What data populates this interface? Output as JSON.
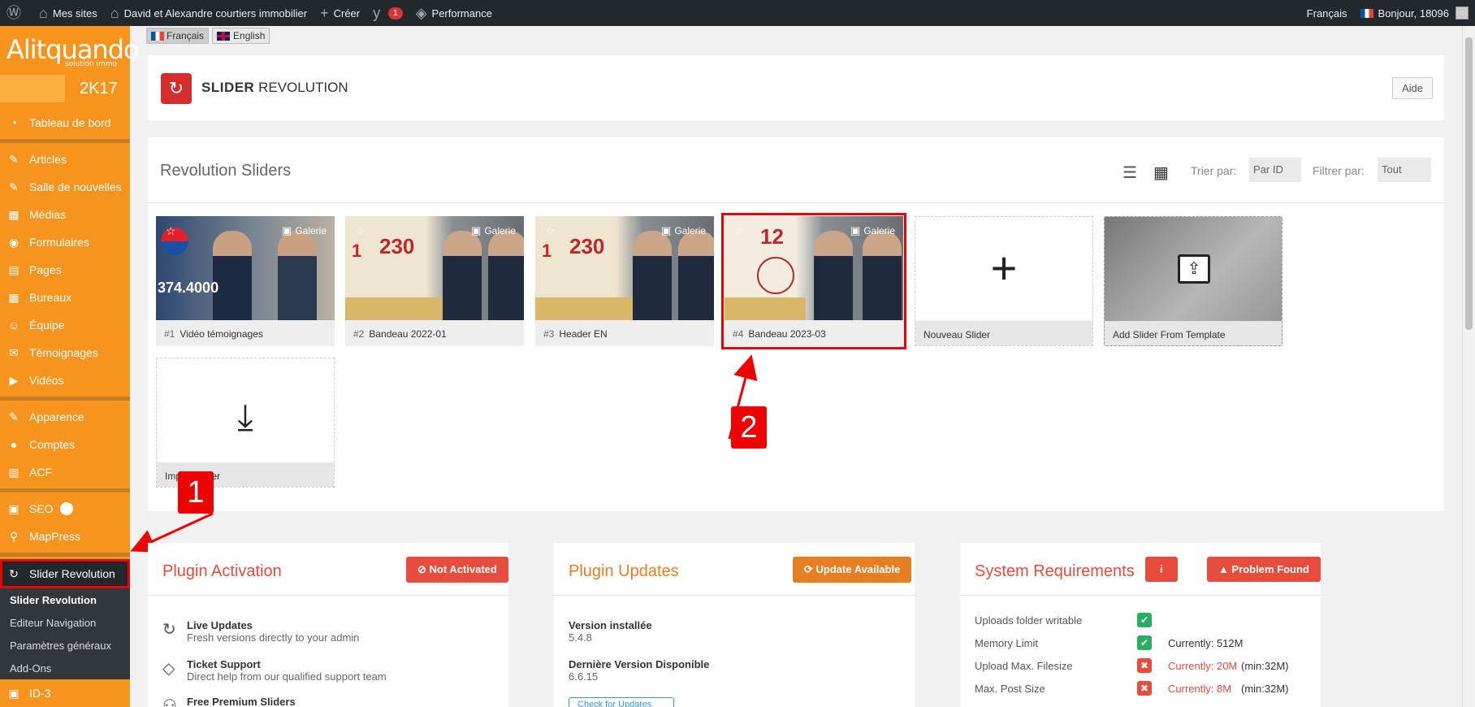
{
  "adminbar": {
    "wp_icon": "wordpress-icon",
    "mes_sites": "Mes sites",
    "site_name": "David et Alexandre courtiers immobilier",
    "creer": "Créer",
    "yoast_count": "1",
    "performance": "Performance",
    "language": "Français",
    "greeting": "Bonjour, 18096"
  },
  "sidebar": {
    "logo": "Alitquando",
    "logo_sub": "solution immo",
    "year": "2K17",
    "items": [
      {
        "label": "Tableau de bord",
        "icon": "dashboard-icon"
      },
      {
        "label": "Articles",
        "icon": "pin-icon"
      },
      {
        "label": "Salle de nouvelles",
        "icon": "pin-icon"
      },
      {
        "label": "Médias",
        "icon": "media-icon"
      },
      {
        "label": "Formulaires",
        "icon": "forms-icon"
      },
      {
        "label": "Pages",
        "icon": "pages-icon"
      },
      {
        "label": "Bureaux",
        "icon": "building-icon"
      },
      {
        "label": "Équipe",
        "icon": "team-icon"
      },
      {
        "label": "Témoignages",
        "icon": "comment-icon"
      },
      {
        "label": "Vidéos",
        "icon": "video-icon"
      },
      {
        "label": "Apparence",
        "icon": "brush-icon"
      },
      {
        "label": "Comptes",
        "icon": "user-icon"
      },
      {
        "label": "ACF",
        "icon": "acf-icon"
      },
      {
        "label": "SEO",
        "icon": "seo-icon"
      },
      {
        "label": "MapPress",
        "icon": "map-pin-icon"
      },
      {
        "label": "Slider Revolution",
        "icon": "refresh-icon"
      }
    ],
    "submenu": [
      "Slider Revolution",
      "Editeur Navigation",
      "Paramètres généraux",
      "Add-Ons"
    ],
    "bottom_item": "ID-3"
  },
  "lang_switcher": {
    "fr": "Français",
    "en": "English"
  },
  "header": {
    "title_bold": "SLIDER",
    "title_rest": "REVOLUTION",
    "help": "Aide"
  },
  "sliders": {
    "title": "Revolution Sliders",
    "sort_label": "Trier par:",
    "sort_value": "Par ID",
    "filter_label": "Filtrer par:",
    "filter_value": "Tout",
    "gallery_label": "Galerie",
    "cards": [
      {
        "id": "#1",
        "name": "Vidéo témoignages"
      },
      {
        "id": "#2",
        "name": "Bandeau 2022-01"
      },
      {
        "id": "#3",
        "name": "Header EN"
      },
      {
        "id": "#4",
        "name": "Bandeau 2023-03"
      }
    ],
    "new_slider": "Nouveau Slider",
    "add_template": "Add Slider From Template",
    "import_slider": "Import Slider",
    "thumb_text_1": "374.4000",
    "thumb_text_230": "230",
    "thumb_text_1b": "1",
    "thumb_text_12": "12"
  },
  "callouts": {
    "one": "1",
    "two": "2"
  },
  "plugin_activation": {
    "title": "Plugin Activation",
    "status": "Not Activated",
    "features": [
      {
        "title": "Live Updates",
        "desc": "Fresh versions directly to your admin"
      },
      {
        "title": "Ticket Support",
        "desc": "Direct help from our qualified support team"
      },
      {
        "title": "Free Premium Sliders",
        "desc": ""
      }
    ]
  },
  "plugin_updates": {
    "title": "Plugin Updates",
    "status": "Update Available",
    "installed_label": "Version installée",
    "installed_value": "5.4.8",
    "latest_label": "Dernière Version Disponible",
    "latest_value": "6.6.15",
    "check_btn": "Check for Updates"
  },
  "system_requirements": {
    "title": "System Requirements",
    "info_btn": "i",
    "status": "Problem Found",
    "rows": [
      {
        "name": "Uploads folder writable",
        "ok": true,
        "current": "",
        "min": ""
      },
      {
        "name": "Memory Limit",
        "ok": true,
        "current": "Currently: 512M",
        "min": ""
      },
      {
        "name": "Upload Max. Filesize",
        "ok": false,
        "current": "Currently: 20M",
        "min": "(min:32M)"
      },
      {
        "name": "Max. Post Size",
        "ok": false,
        "current": "Currently: 8M",
        "min": "(min:32M)"
      }
    ]
  },
  "colors": {
    "sidebar": "#f7941d",
    "adminbar": "#23282d",
    "red": "#e74c3c",
    "orange": "#e67e22",
    "highlight": "#ee0000"
  }
}
